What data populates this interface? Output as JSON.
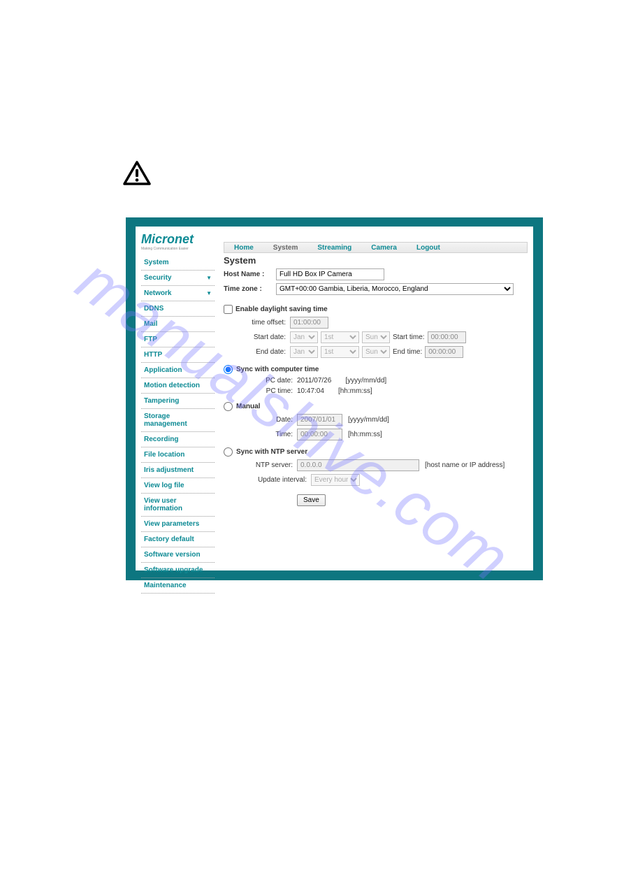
{
  "logo": {
    "text": "Micronet",
    "tagline": "Making Communication Easier"
  },
  "topnav": [
    "Home",
    "System",
    "Streaming",
    "Camera",
    "Logout"
  ],
  "topnav_active": 1,
  "sidebar": [
    {
      "label": "System",
      "expandable": false
    },
    {
      "label": "Security",
      "expandable": true
    },
    {
      "label": "Network",
      "expandable": true
    },
    {
      "label": "DDNS",
      "expandable": false
    },
    {
      "label": "Mail",
      "expandable": false
    },
    {
      "label": "FTP",
      "expandable": false
    },
    {
      "label": "HTTP",
      "expandable": false
    },
    {
      "label": "Application",
      "expandable": false
    },
    {
      "label": "Motion detection",
      "expandable": false
    },
    {
      "label": "Tampering",
      "expandable": false
    },
    {
      "label": "Storage management",
      "expandable": false
    },
    {
      "label": "Recording",
      "expandable": false
    },
    {
      "label": "File location",
      "expandable": false
    },
    {
      "label": "Iris adjustment",
      "expandable": false
    },
    {
      "label": "View log file",
      "expandable": false
    },
    {
      "label": "View user information",
      "expandable": false
    },
    {
      "label": "View parameters",
      "expandable": false
    },
    {
      "label": "Factory default",
      "expandable": false
    },
    {
      "label": "Software version",
      "expandable": false
    },
    {
      "label": "Software upgrade",
      "expandable": false
    },
    {
      "label": "Maintenance",
      "expandable": false
    }
  ],
  "page_title": "System",
  "hostname": {
    "label": "Host Name :",
    "value": "Full HD Box IP Camera"
  },
  "timezone": {
    "label": "Time zone :",
    "value": "GMT+00:00 Gambia, Liberia, Morocco, England"
  },
  "dst": {
    "label": "Enable daylight saving time",
    "time_offset": {
      "label": "time offset:",
      "value": "01:00:00"
    },
    "start": {
      "label": "Start date:",
      "month": "Jan",
      "week": "1st",
      "day": "Sun",
      "time_label": "Start time:",
      "time": "00:00:00"
    },
    "end": {
      "label": "End date:",
      "month": "Jan",
      "week": "1st",
      "day": "Sun",
      "time_label": "End time:",
      "time": "00:00:00"
    }
  },
  "sync_computer": {
    "label": "Sync with computer time",
    "pc_date": {
      "label": "PC date:",
      "value": "2011/07/26",
      "hint": "[yyyy/mm/dd]"
    },
    "pc_time": {
      "label": "PC time:",
      "value": "10:47:04",
      "hint": "[hh:mm:ss]"
    }
  },
  "manual": {
    "label": "Manual",
    "date": {
      "label": "Date:",
      "value": "2007/01/01",
      "hint": "[yyyy/mm/dd]"
    },
    "time": {
      "label": "Time:",
      "value": "00:00:00",
      "hint": "[hh:mm:ss]"
    }
  },
  "ntp": {
    "label": "Sync with NTP server",
    "server": {
      "label": "NTP server:",
      "value": "0.0.0.0",
      "hint": "[host name or IP address]"
    },
    "interval": {
      "label": "Update interval:",
      "value": "Every hour"
    }
  },
  "save_button": "Save",
  "watermark": "manualshive.com"
}
